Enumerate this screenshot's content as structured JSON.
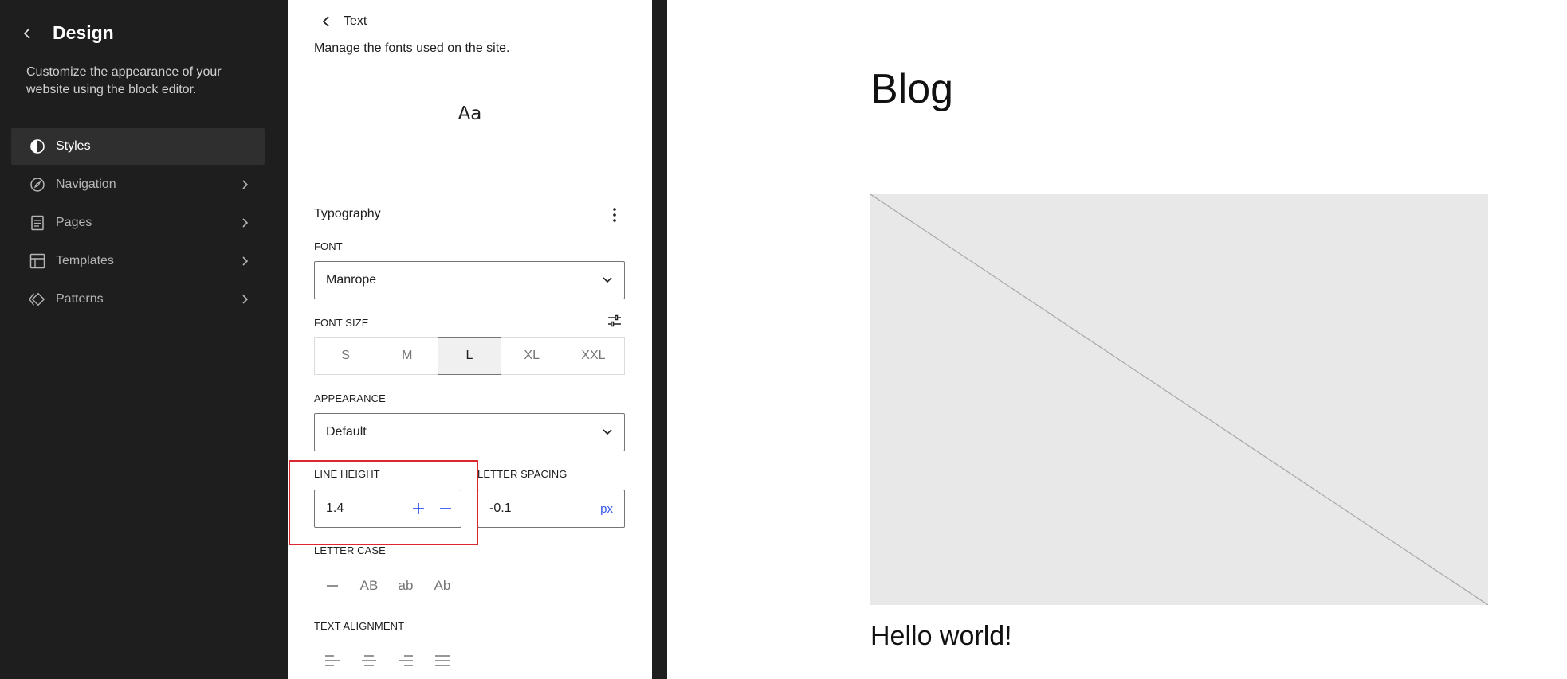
{
  "sidebar": {
    "title": "Design",
    "description": "Customize the appearance of your website using the block editor.",
    "items": [
      {
        "label": "Styles",
        "icon": "half-circle-icon",
        "active": true
      },
      {
        "label": "Navigation",
        "icon": "compass-icon"
      },
      {
        "label": "Pages",
        "icon": "page-icon"
      },
      {
        "label": "Templates",
        "icon": "layout-icon"
      },
      {
        "label": "Patterns",
        "icon": "diamond-icon"
      }
    ]
  },
  "panel": {
    "title": "Text",
    "description": "Manage the fonts used on the site.",
    "preview": "Aa",
    "typography_heading": "Typography",
    "font": {
      "label": "FONT",
      "value": "Manrope"
    },
    "font_size": {
      "label": "FONT SIZE",
      "options": [
        "S",
        "M",
        "L",
        "XL",
        "XXL"
      ],
      "selected": "L"
    },
    "appearance": {
      "label": "APPEARANCE",
      "value": "Default"
    },
    "line_height": {
      "label": "LINE HEIGHT",
      "value": "1.4"
    },
    "letter_spacing": {
      "label": "LETTER SPACING",
      "value": "-0.1",
      "unit": "px"
    },
    "letter_case": {
      "label": "LETTER CASE",
      "options": [
        "AB",
        "ab",
        "Ab"
      ]
    },
    "text_alignment": {
      "label": "TEXT ALIGNMENT"
    }
  },
  "canvas": {
    "blog_title": "Blog",
    "post_title": "Hello world!"
  },
  "colors": {
    "accent": "#3858e9",
    "highlight": "#d9282f",
    "dark": "#1e1e1e"
  }
}
